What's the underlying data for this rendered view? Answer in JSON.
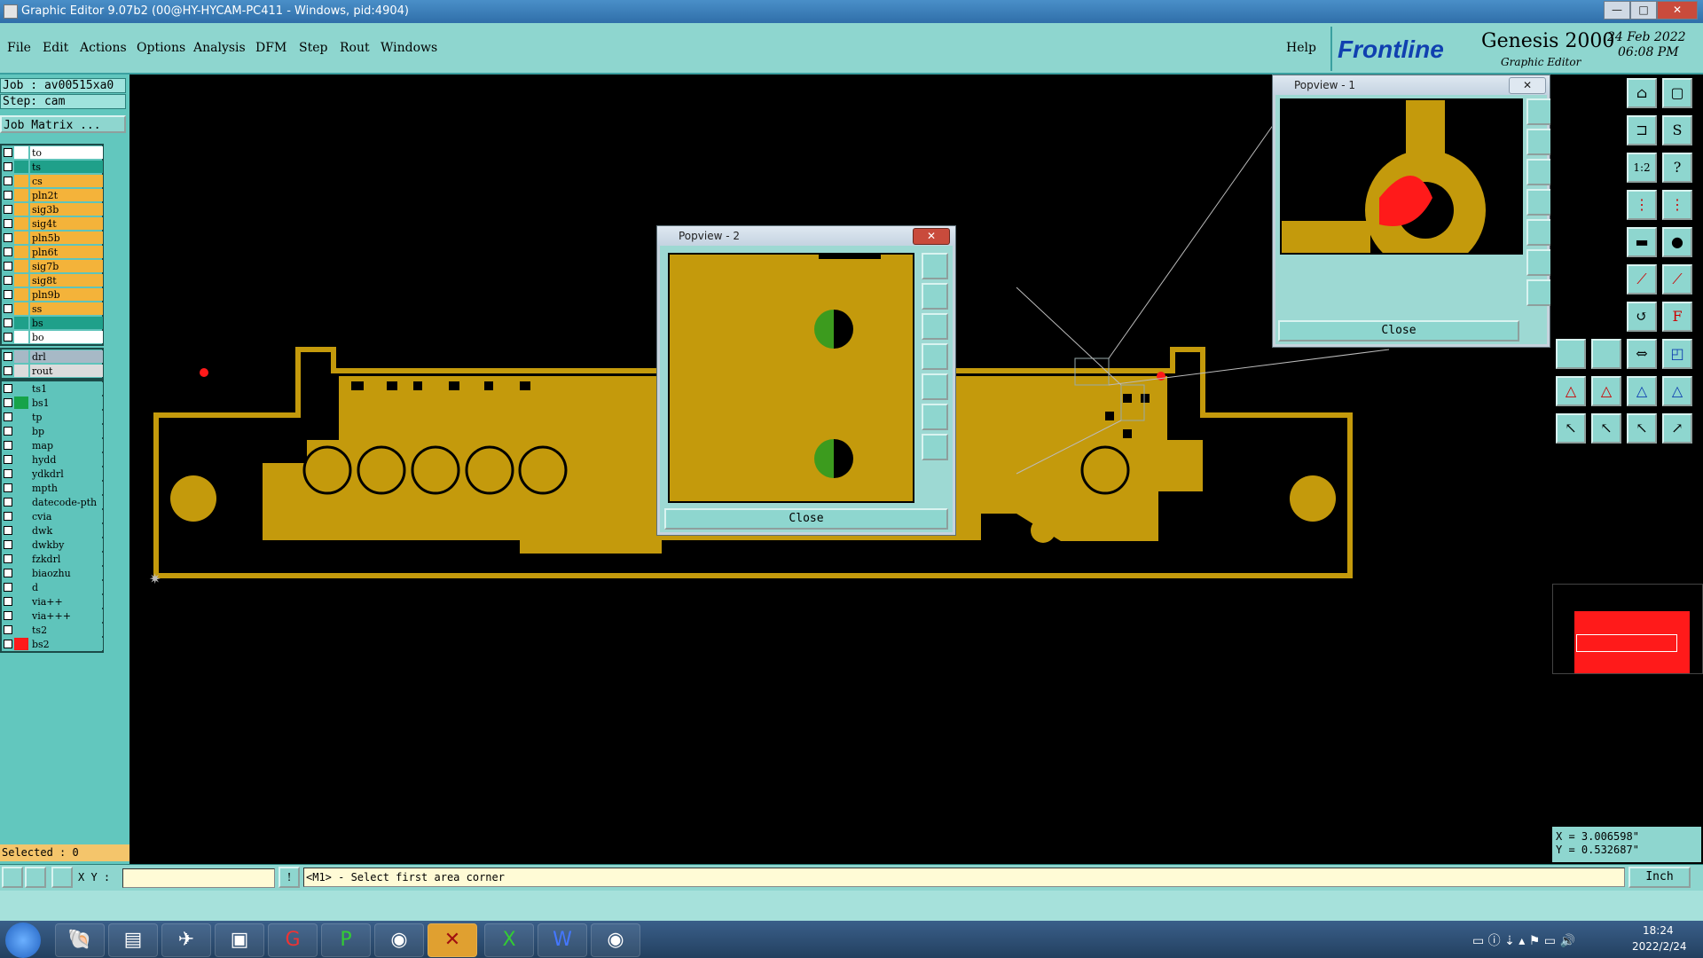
{
  "window": {
    "title": "Graphic Editor 9.07b2 (00@HY-HYCAM-PC411 - Windows, pid:4904)",
    "min": "—",
    "max": "□",
    "close": "✕"
  },
  "menu": {
    "items": [
      "File",
      "Edit",
      "Actions",
      "Options",
      "Analysis",
      "DFM",
      "Step",
      "Rout",
      "Windows"
    ],
    "help": "Help"
  },
  "brand": {
    "logo": "Frontline",
    "product": "Genesis 2000",
    "subtitle": "Graphic Editor",
    "date": "24 Feb 2022",
    "time": "06:08 PM"
  },
  "job": {
    "job_line": "Job : av00515xa0",
    "step_line": "Step: cam",
    "matrix_label": "Job Matrix ..."
  },
  "layers_group1": [
    {
      "name": "to",
      "bg": "#ffffff",
      "sw": "#ffffff"
    },
    {
      "name": "ts",
      "bg": "#1fa08a",
      "sw": "#1fa08a"
    },
    {
      "name": "cs",
      "bg": "#f4b33a",
      "sw": "#f4b33a"
    },
    {
      "name": "pln2t",
      "bg": "#f4b33a",
      "sw": "#f4b33a"
    },
    {
      "name": "sig3b",
      "bg": "#f4b33a",
      "sw": "#f4b33a"
    },
    {
      "name": "sig4t",
      "bg": "#f4b33a",
      "sw": "#f4b33a"
    },
    {
      "name": "pln5b",
      "bg": "#f4b33a",
      "sw": "#f4b33a"
    },
    {
      "name": "pln6t",
      "bg": "#f4b33a",
      "sw": "#f4b33a"
    },
    {
      "name": "sig7b",
      "bg": "#f4b33a",
      "sw": "#f4b33a"
    },
    {
      "name": "sig8t",
      "bg": "#f4b33a",
      "sw": "#f4b33a"
    },
    {
      "name": "pln9b",
      "bg": "#f4b33a",
      "sw": "#f4b33a"
    },
    {
      "name": "ss",
      "bg": "#f4b33a",
      "sw": "#f4b33a"
    },
    {
      "name": "bs",
      "bg": "#1fa08a",
      "sw": "#1fa08a"
    },
    {
      "name": "bo",
      "bg": "#ffffff",
      "sw": "#ffffff"
    }
  ],
  "layers_group2": [
    {
      "name": "drl",
      "bg": "#a7b9c6",
      "sw": "#a7b9c6"
    },
    {
      "name": "rout",
      "bg": "#dcdcdc",
      "sw": "#dcdcdc"
    }
  ],
  "layers_group3": [
    {
      "name": "ts1",
      "bg": "#5fc4bb",
      "sw": "#5fc4bb"
    },
    {
      "name": "bs1",
      "bg": "#5fc4bb",
      "sw": "#16a34a"
    },
    {
      "name": "tp",
      "bg": "#5fc4bb",
      "sw": "#5fc4bb"
    },
    {
      "name": "bp",
      "bg": "#5fc4bb",
      "sw": "#5fc4bb"
    },
    {
      "name": "map",
      "bg": "#5fc4bb",
      "sw": "#5fc4bb"
    },
    {
      "name": "hydd",
      "bg": "#5fc4bb",
      "sw": "#5fc4bb"
    },
    {
      "name": "ydkdrl",
      "bg": "#5fc4bb",
      "sw": "#5fc4bb"
    },
    {
      "name": "mpth",
      "bg": "#5fc4bb",
      "sw": "#5fc4bb"
    },
    {
      "name": "datecode-pth",
      "bg": "#5fc4bb",
      "sw": "#5fc4bb"
    },
    {
      "name": "cvia",
      "bg": "#5fc4bb",
      "sw": "#5fc4bb"
    },
    {
      "name": "dwk",
      "bg": "#5fc4bb",
      "sw": "#5fc4bb"
    },
    {
      "name": "dwkby",
      "bg": "#5fc4bb",
      "sw": "#5fc4bb"
    },
    {
      "name": "fzkdrl",
      "bg": "#5fc4bb",
      "sw": "#5fc4bb"
    },
    {
      "name": "biaozhu",
      "bg": "#5fc4bb",
      "sw": "#5fc4bb"
    },
    {
      "name": "d",
      "bg": "#5fc4bb",
      "sw": "#5fc4bb"
    },
    {
      "name": "via++",
      "bg": "#5fc4bb",
      "sw": "#5fc4bb"
    },
    {
      "name": "via+++",
      "bg": "#5fc4bb",
      "sw": "#5fc4bb"
    },
    {
      "name": "ts2",
      "bg": "#5fc4bb",
      "sw": "#5fc4bb"
    },
    {
      "name": "bs2",
      "bg": "#5fc4bb",
      "sw": "#ff1a1a"
    }
  ],
  "selected": "Selected : 0",
  "popview2": {
    "title": "Popview - 2",
    "close": "Close"
  },
  "popview1": {
    "title": "Popview - 1",
    "close": "Close"
  },
  "coords": {
    "x": "X = 3.006598\"",
    "y": "Y = 0.532687\""
  },
  "bottom": {
    "xy_label": "X Y :",
    "xy_value": "",
    "prompt": "<M1> - Select first area corner",
    "units": "Inch"
  },
  "taskbar": {
    "time": "18:24",
    "date": "2022/2/24"
  },
  "colors": {
    "copper": "#c49a0c",
    "panel": "#8ed6cf",
    "highlight": "#ff1a1a"
  }
}
